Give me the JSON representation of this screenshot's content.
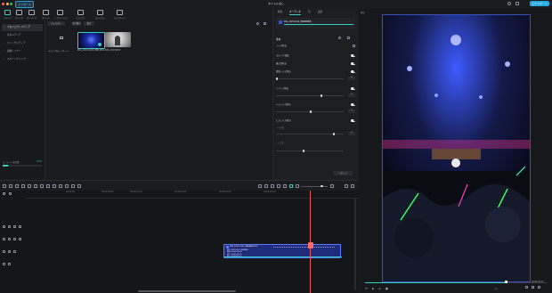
{
  "titlebar": {
    "import_label": "インポート",
    "project_title": "タイトルなし",
    "export_label": "エクスポート"
  },
  "media_tabs": [
    {
      "label": "メディア",
      "active": true
    },
    {
      "label": "ストック",
      "active": false
    },
    {
      "label": "オーディオ",
      "active": false
    },
    {
      "label": "タイトル",
      "active": false
    },
    {
      "label": "トランジション",
      "active": false
    },
    {
      "label": "エフェクト",
      "active": false
    },
    {
      "label": "ステッカー",
      "active": false
    },
    {
      "label": "テンプレート",
      "active": false
    }
  ],
  "sidebar": {
    "items": [
      {
        "label": "プロジェクトメディア",
        "active": true
      },
      {
        "label": "共有メディア",
        "active": false
      },
      {
        "label": "ストックメディア",
        "active": false
      },
      {
        "label": "調整レイヤー",
        "active": false
      },
      {
        "label": "スマートクリップ",
        "active": false
      }
    ],
    "storage_label": "ストレージ使用量",
    "storage_value": "0.0%",
    "storage_fraction": 0.14
  },
  "media": {
    "folder_label": "フォルダー",
    "sort_label": "並べ替え",
    "view_label": "表示",
    "import_tile_label": "メディアをインポート",
    "clips": [
      {
        "name": "IMG_2023-0102_BBB.MOV"
      },
      {
        "name": "IMG_2023.MOV"
      }
    ]
  },
  "props": {
    "tabs": [
      {
        "label": "動画",
        "active": false
      },
      {
        "label": "オーディオ",
        "active": true
      },
      {
        "label": "色",
        "active": false
      },
      {
        "label": "速度",
        "active": false
      }
    ],
    "clip_name": "IMG_2023-0102_BBBBBBBB",
    "section_label": "基本",
    "rows": [
      {
        "label": "ノイズ除去"
      },
      {
        "label": "スピーチ強調"
      },
      {
        "label": "風の音除去"
      },
      {
        "label": "環境ノイズ除去"
      },
      {
        "label": "リバーブ除去"
      },
      {
        "label": "ハムノイズ除去"
      },
      {
        "label": "ヒスノイズ除去"
      }
    ],
    "sub_labels": [
      "ノイズ量",
      "ノイズ量",
      "ノイズ量"
    ],
    "values": [
      "50",
      "70",
      "50",
      "50"
    ],
    "reset_label": "リセット"
  },
  "preview": {
    "tab_label": "再生",
    "time": "00:00:09:13",
    "total": "00:00:15:27",
    "quality": "フル",
    "progress": 0.78
  },
  "timeline": {
    "ruler_times": [
      "00:00:00",
      "00:00:05:00",
      "00:00:10:00",
      "00:00:15:00",
      "00:00:20:00",
      "00:00:25:00"
    ],
    "clip": {
      "title": "IMG_2023-0102_BBBBBB.MOV",
      "line1": "IMG_2023-0102_BBBBBB",
      "line2": "開始: 00:00:00:00",
      "line3": "終了: 00:00:15:27",
      "line4": "長さ: 00:00:15:27",
      "line5": "再生時間: 00:00:15:27"
    }
  },
  "colors": {
    "accent": "#33d0c0",
    "brand": "#23a8e0",
    "playhead": "#e85a5a",
    "clip": "#1e2a7a"
  }
}
